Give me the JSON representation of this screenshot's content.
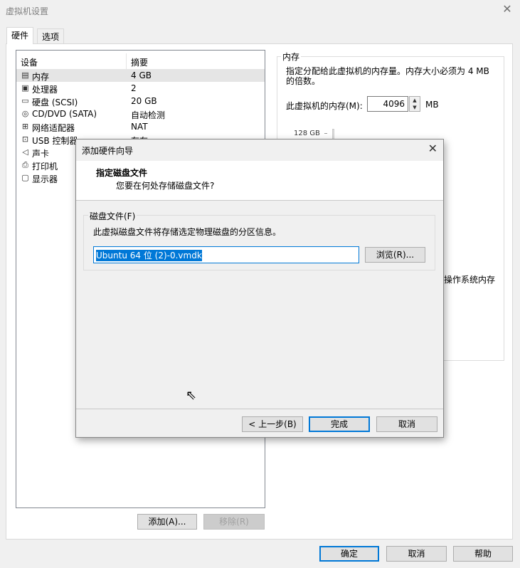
{
  "window": {
    "title": "虚拟机设置"
  },
  "tabs": [
    "硬件",
    "选项"
  ],
  "device_list": {
    "headers": [
      "设备",
      "摘要"
    ],
    "rows": [
      {
        "icon": "memory-icon",
        "name": "内存",
        "summary": "4 GB"
      },
      {
        "icon": "cpu-icon",
        "name": "处理器",
        "summary": "2"
      },
      {
        "icon": "disk-icon",
        "name": "硬盘 (SCSI)",
        "summary": "20 GB"
      },
      {
        "icon": "cd-icon",
        "name": "CD/DVD (SATA)",
        "summary": "自动检测"
      },
      {
        "icon": "network-icon",
        "name": "网络适配器",
        "summary": "NAT"
      },
      {
        "icon": "usb-icon",
        "name": "USB 控制器",
        "summary": "存在"
      },
      {
        "icon": "sound-icon",
        "name": "声卡",
        "summary": ""
      },
      {
        "icon": "printer-icon",
        "name": "打印机",
        "summary": ""
      },
      {
        "icon": "display-icon",
        "name": "显示器",
        "summary": ""
      }
    ]
  },
  "memory": {
    "legend": "内存",
    "description": "指定分配给此虚拟机的内存量。内存大小必须为 4 MB 的倍数。",
    "label": "此虚拟机的内存(M):",
    "value": "4096",
    "unit": "MB",
    "scale_top": "128 GB",
    "os_memory_text": "操作系统内存"
  },
  "buttons": {
    "add": "添加(A)...",
    "remove": "移除(R)",
    "ok": "确定",
    "cancel": "取消",
    "help": "帮助"
  },
  "dialog": {
    "title": "添加硬件向导",
    "heading": "指定磁盘文件",
    "subheading": "您要在何处存储磁盘文件?",
    "group_label": "磁盘文件(F)",
    "group_desc": "此虚拟磁盘文件将存储选定物理磁盘的分区信息。",
    "file_value": "Ubuntu 64 位 (2)-0.vmdk",
    "browse": "浏览(R)...",
    "back": "< 上一步(B)",
    "finish": "完成",
    "cancel": "取消"
  }
}
